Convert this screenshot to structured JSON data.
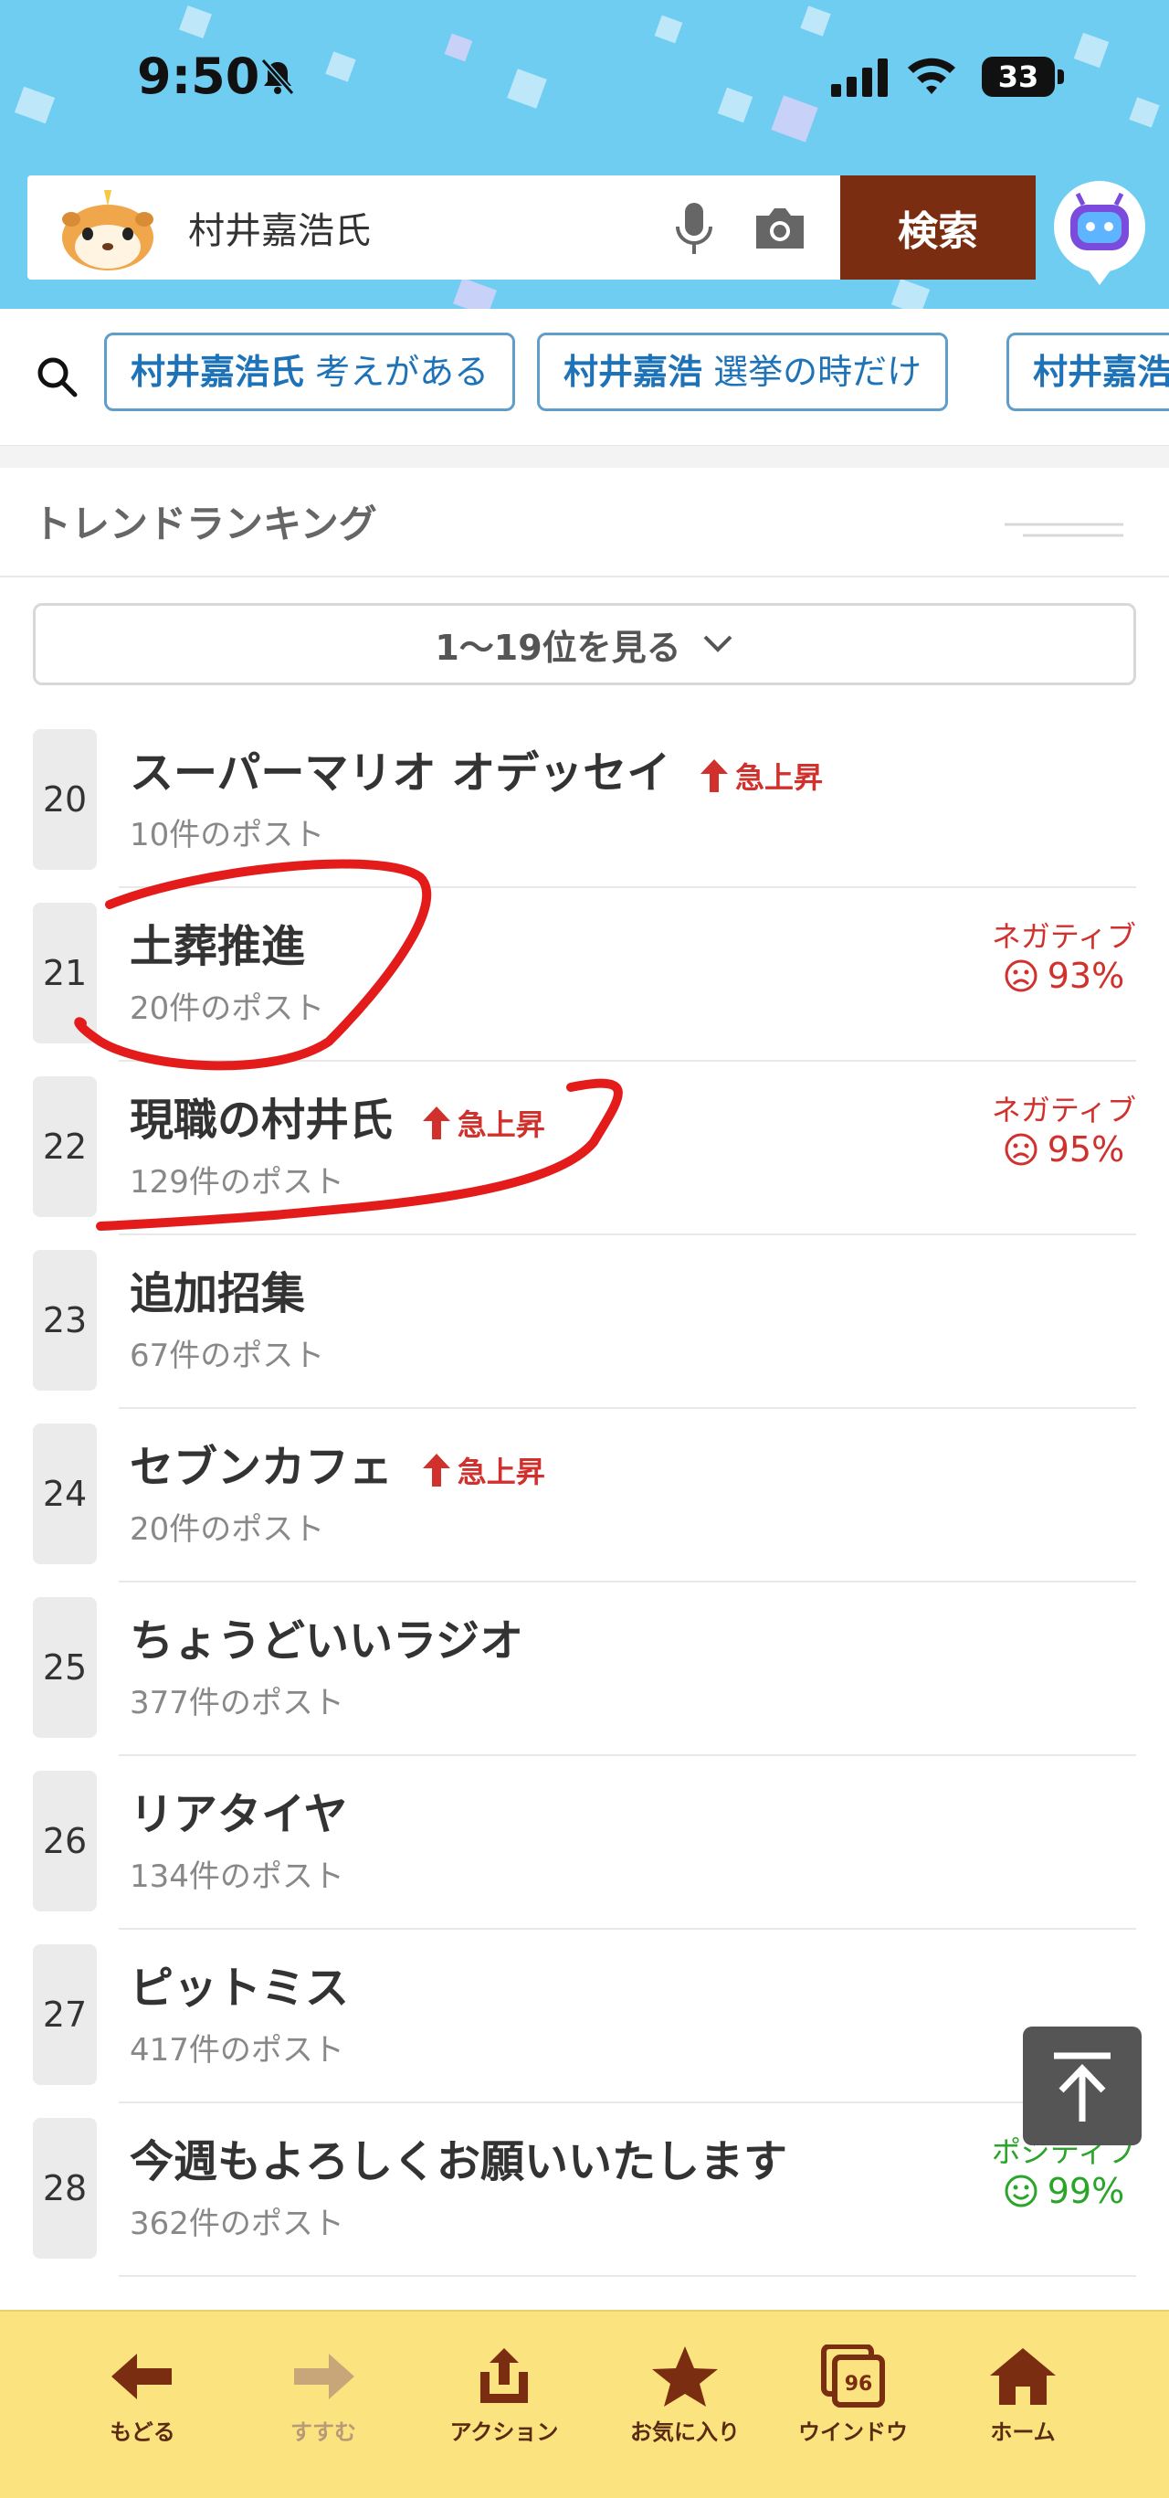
{
  "status_bar": {
    "time": "9:50",
    "battery": "33"
  },
  "search": {
    "query": "村井嘉浩氏",
    "button_label": "検索"
  },
  "suggestions": [
    {
      "bold": "村井嘉浩氏",
      "rest": " 考えがある"
    },
    {
      "bold": "村井嘉浩",
      "rest": " 選挙の時だけ"
    },
    {
      "bold": "村井嘉浩",
      "rest": ""
    }
  ],
  "ranking": {
    "title": "トレンドランキング",
    "expand_label": "1〜19位を見る",
    "items": [
      {
        "rank": "20",
        "title": "スーパーマリオ オデッセイ",
        "count": "10件のポスト",
        "rising": "急上昇"
      },
      {
        "rank": "21",
        "title": "土葬推進",
        "count": "20件のポスト",
        "sentiment_label": "ネガティブ",
        "sentiment_value": "93%"
      },
      {
        "rank": "22",
        "title": "現職の村井氏",
        "count": "129件のポスト",
        "rising": "急上昇",
        "sentiment_label": "ネガティブ",
        "sentiment_value": "95%"
      },
      {
        "rank": "23",
        "title": "追加招集",
        "count": "67件のポスト"
      },
      {
        "rank": "24",
        "title": "セブンカフェ",
        "count": "20件のポスト",
        "rising": "急上昇"
      },
      {
        "rank": "25",
        "title": "ちょうどいいラジオ",
        "count": "377件のポスト"
      },
      {
        "rank": "26",
        "title": "リアタイヤ",
        "count": "134件のポスト"
      },
      {
        "rank": "27",
        "title": "ピットミス",
        "count": "417件のポスト"
      },
      {
        "rank": "28",
        "title": "今週もよろしくお願いいたします",
        "count": "362件のポスト",
        "sentiment_label": "ポジティブ",
        "sentiment_value": "99%"
      }
    ]
  },
  "bottom_nav": [
    {
      "label": "もどる",
      "icon": "back-arrow-icon"
    },
    {
      "label": "すすむ",
      "icon": "forward-arrow-icon"
    },
    {
      "label": "アクション",
      "icon": "share-icon"
    },
    {
      "label": "お気に入り",
      "icon": "star-icon"
    },
    {
      "label": "ウインドウ",
      "icon": "windows-icon",
      "badge": "96"
    },
    {
      "label": "ホーム",
      "icon": "home-icon"
    }
  ],
  "colors": {
    "header_bg": "#6fcdf2",
    "search_button": "#7b2d12",
    "chip_text": "#1e73b8",
    "negative": "#d0312d",
    "positive": "#2aa52a",
    "bottom_bar": "#fbe47f"
  }
}
